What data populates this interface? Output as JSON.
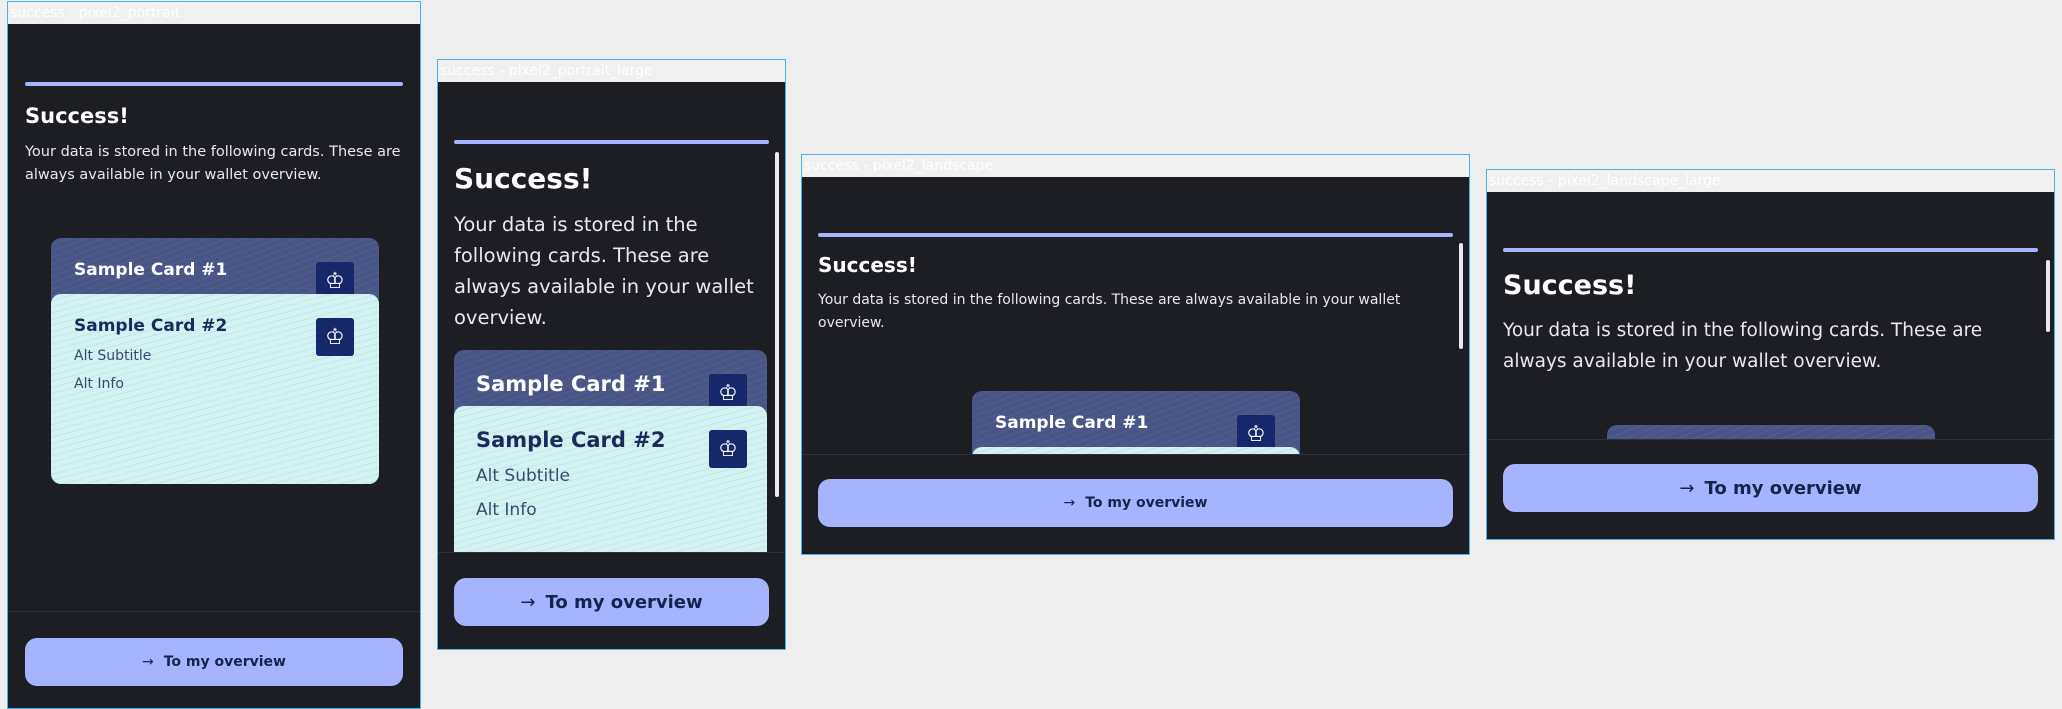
{
  "frames": [
    {
      "label": "success - pixel2_portrait"
    },
    {
      "label": "success - pixel2_portrait_large"
    },
    {
      "label": "success - pixel2_landscape"
    },
    {
      "label": "success - pixel2_landscape_large"
    }
  ],
  "success": {
    "title": "Success!",
    "description": "Your data is stored in the following cards. These are always available in your wallet overview.",
    "button_label": "To my overview",
    "button_icon": "arrow-right-icon"
  },
  "cards": [
    {
      "title": "Sample Card #1",
      "subtitle": "",
      "info": ""
    },
    {
      "title": "Sample Card #2",
      "subtitle": "Alt Subtitle",
      "info": "Alt Info"
    }
  ],
  "colors": {
    "background": "#1c1e24",
    "accent": "#a6b4ff",
    "card1": "#4a5587",
    "card2": "#d3f2f2",
    "crest": "#17286a",
    "frame_border": "#4ab0e6"
  }
}
